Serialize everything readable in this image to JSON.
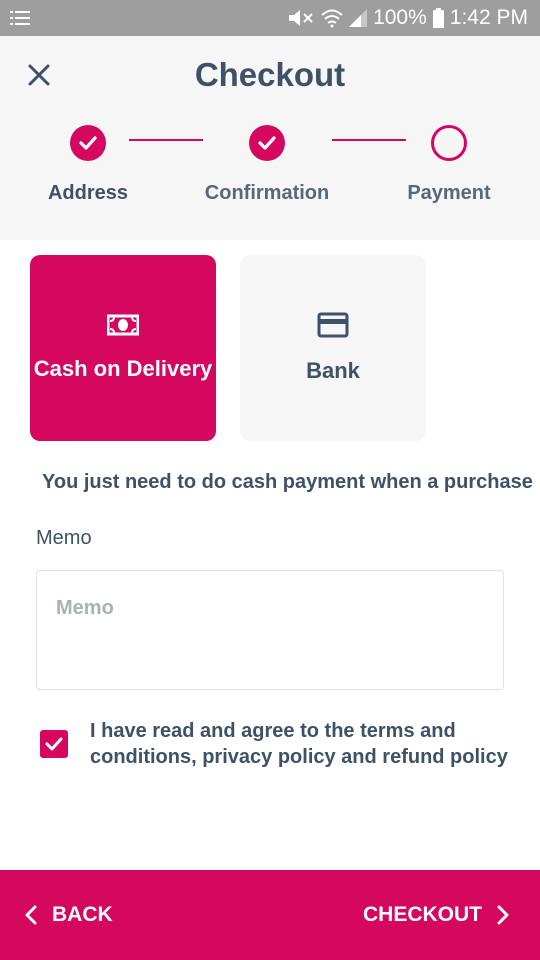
{
  "status_bar": {
    "battery": "100%",
    "time": "1:42 PM"
  },
  "header": {
    "title": "Checkout",
    "steps": [
      {
        "label": "Address",
        "state": "done"
      },
      {
        "label": "Confirmation",
        "state": "done"
      },
      {
        "label": "Payment",
        "state": "current"
      }
    ]
  },
  "payment_methods": [
    {
      "label": "Cash on Delivery",
      "icon": "cash-icon",
      "selected": true
    },
    {
      "label": "Bank",
      "icon": "credit-card-icon",
      "selected": false
    }
  ],
  "info_text": "You just need to do cash payment when a purchase",
  "memo": {
    "label": "Memo",
    "placeholder": "Memo",
    "value": ""
  },
  "agreement": {
    "checked": true,
    "text": "I have read and agree to the terms and conditions, privacy policy and refund policy"
  },
  "footer": {
    "back_label": "BACK",
    "checkout_label": "CHECKOUT"
  },
  "colors": {
    "accent": "#d6075f",
    "text": "#3e5168",
    "status_bar": "#9e9e9e",
    "header_bg": "#f6f6f6"
  }
}
